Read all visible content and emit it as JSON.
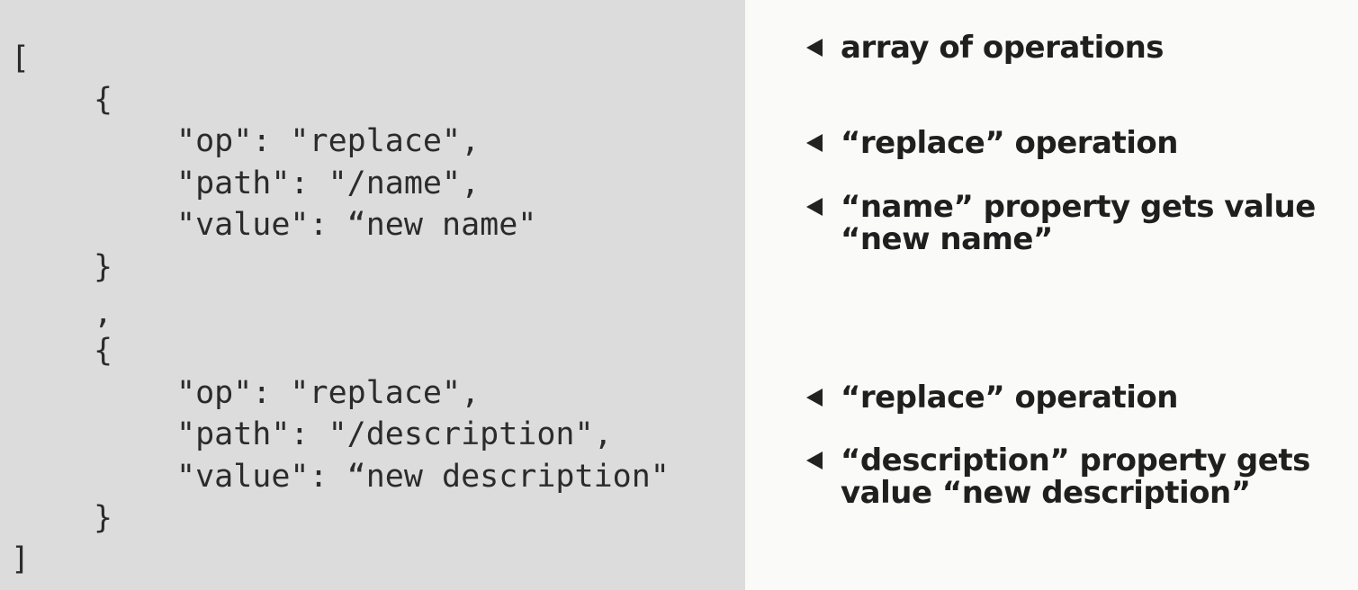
{
  "code": {
    "lines": [
      "[",
      "{",
      "\"op\": \"replace\",",
      "\"path\": \"/name\",",
      "\"value\": “new name\"",
      "}",
      ",",
      "{",
      "\"op\": \"replace\",",
      "\"path\": \"/description\",",
      "\"value\": “new description\"",
      "}",
      "]"
    ]
  },
  "annotations": {
    "items": [
      {
        "label": "array of operations",
        "icon": "left-triangle-arrow-icon"
      },
      {
        "label": "“replace” operation",
        "icon": "left-triangle-arrow-icon"
      },
      {
        "label": "“name” property gets value “new name”",
        "icon": "left-triangle-arrow-icon"
      },
      {
        "label": "“replace” operation",
        "icon": "left-triangle-arrow-icon"
      },
      {
        "label": "“description” property gets value “new description”",
        "icon": "left-triangle-arrow-icon"
      }
    ]
  }
}
